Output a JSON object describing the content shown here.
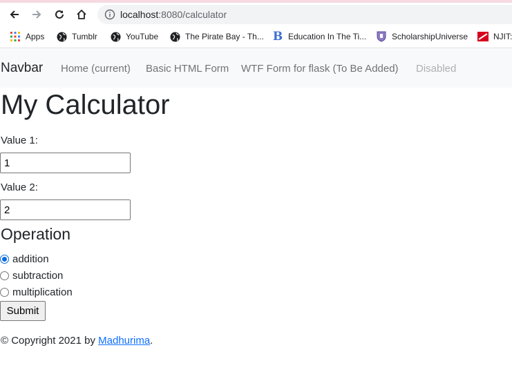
{
  "browser": {
    "url_host": "localhost",
    "url_rest": ":8080/calculator",
    "bookmarks": [
      {
        "label": "Apps",
        "icon": "apps-grid-icon"
      },
      {
        "label": "Tumblr",
        "icon": "globe-icon"
      },
      {
        "label": "YouTube",
        "icon": "globe-icon"
      },
      {
        "label": "The Pirate Bay - Th...",
        "icon": "globe-icon"
      },
      {
        "label": "Education In The Ti...",
        "icon": "bold-b-icon"
      },
      {
        "label": "ScholarshipUniverse",
        "icon": "shield-crest-icon"
      },
      {
        "label": "NJIT:",
        "icon": "njit-flag-icon"
      }
    ]
  },
  "navbar": {
    "brand": "Navbar",
    "links": [
      {
        "label": "Home (current)"
      },
      {
        "label": "Basic HTML Form"
      },
      {
        "label": "WTF Form for flask (To Be Added)"
      },
      {
        "label": "Disabled"
      }
    ]
  },
  "page": {
    "title": "My Calculator",
    "value1_label": "Value 1:",
    "value1": "1",
    "value2_label": "Value 2:",
    "value2": "2",
    "operation_title": "Operation",
    "operations": [
      {
        "label": "addition",
        "checked": true
      },
      {
        "label": "subtraction",
        "checked": false
      },
      {
        "label": "multiplication",
        "checked": false
      }
    ],
    "submit_label": "Submit"
  },
  "footer": {
    "prefix": "© Copyright 2021 by ",
    "author": "Madhurima",
    "suffix": "."
  },
  "colors": {
    "link": "#0d6efd",
    "radio_checked": "#0b6bde",
    "navbar_bg": "#f8f9fa"
  }
}
